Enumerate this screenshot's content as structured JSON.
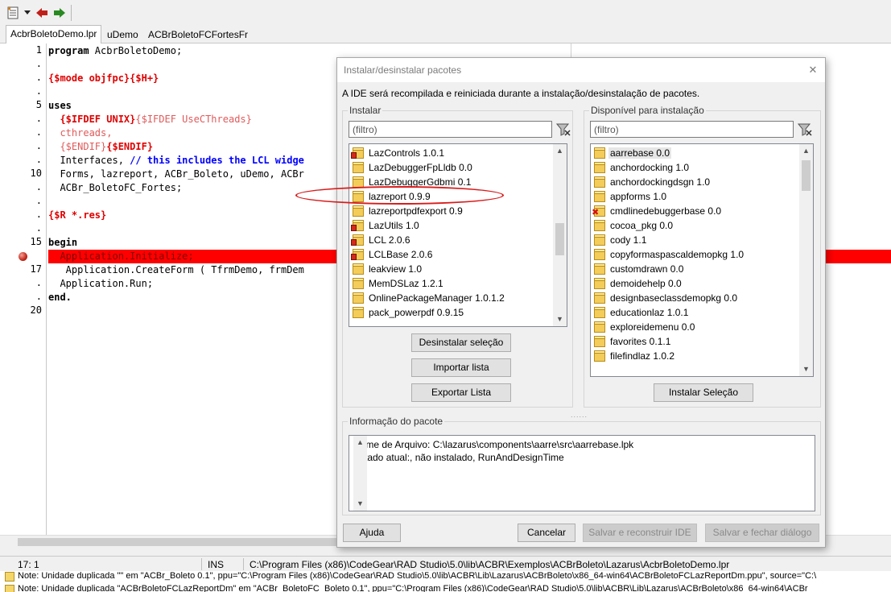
{
  "toolbar": {
    "icons": [
      "document-list-icon",
      "chevron-down-icon",
      "back-arrow-icon",
      "forward-arrow-icon"
    ],
    "colors": {
      "back": "#c0201a",
      "forward": "#2a8a22"
    }
  },
  "tabs": [
    {
      "label": "AcbrBoletoDemo.lpr",
      "active": true
    },
    {
      "label": "uDemo",
      "active": false
    },
    {
      "label": "ACBrBoletoFCFortesFr",
      "active": false
    }
  ],
  "editor": {
    "gutter": [
      "1",
      ".",
      ".",
      ".",
      "5",
      ".",
      ".",
      ".",
      ".",
      "10",
      ".",
      ".",
      ".",
      ".",
      "15",
      "",
      "17",
      ".",
      ".",
      "20"
    ],
    "lines": [
      {
        "parts": [
          {
            "t": "program",
            "c": "kw"
          },
          {
            "t": " AcbrBoletoDemo;",
            "c": "plain"
          }
        ]
      },
      {
        "parts": []
      },
      {
        "parts": [
          {
            "t": "{$mode objfpc}{$H+}",
            "c": "dir"
          }
        ]
      },
      {
        "parts": []
      },
      {
        "parts": [
          {
            "t": "uses",
            "c": "kw"
          }
        ]
      },
      {
        "parts": [
          {
            "t": "  {$IFDEF UNIX}",
            "c": "dir"
          },
          {
            "t": "{$IFDEF UseCThreads}",
            "c": "dirl"
          }
        ]
      },
      {
        "parts": [
          {
            "t": "  cthreads,",
            "c": "dirl"
          }
        ]
      },
      {
        "parts": [
          {
            "t": "  {$ENDIF}",
            "c": "dirl"
          },
          {
            "t": "{$ENDIF}",
            "c": "dir"
          }
        ]
      },
      {
        "parts": [
          {
            "t": "  Interfaces, ",
            "c": "plain"
          },
          {
            "t": "// this includes the LCL widge",
            "c": "cm"
          }
        ]
      },
      {
        "parts": [
          {
            "t": "  Forms, lazreport, ACBr_Boleto, uDemo, ACBr",
            "c": "plain"
          }
        ]
      },
      {
        "parts": [
          {
            "t": "  ACBr_BoletoFC_Fortes;",
            "c": "plain"
          }
        ]
      },
      {
        "parts": []
      },
      {
        "parts": [
          {
            "t": "{$R *.res}",
            "c": "dir"
          }
        ]
      },
      {
        "parts": []
      },
      {
        "parts": [
          {
            "t": "begin",
            "c": "kw"
          }
        ]
      },
      {
        "parts": [
          {
            "t": "  Application.Initialize;",
            "c": "hl-text"
          }
        ]
      },
      {
        "parts": [
          {
            "t": "   Application.CreateForm ( TfrmDemo, frmDem",
            "c": "plain"
          }
        ]
      },
      {
        "parts": [
          {
            "t": "  Application.Run;",
            "c": "plain"
          }
        ]
      },
      {
        "parts": [
          {
            "t": "end.",
            "c": "kw"
          }
        ]
      },
      {
        "parts": []
      }
    ],
    "highlight_color": "#ff0000"
  },
  "status": {
    "position": "17:  1",
    "mode": "INS",
    "file": "C:\\Program Files (x86)\\CodeGear\\RAD Studio\\5.0\\lib\\ACBR\\Exemplos\\ACBrBoleto\\Lazarus\\AcbrBoletoDemo.lpr"
  },
  "messages": [
    "Note: Unidade duplicada \"\" em \"ACBr_Boleto 0.1\", ppu=\"C:\\Program Files (x86)\\CodeGear\\RAD Studio\\5.0\\lib\\ACBR\\Lib\\Lazarus\\ACBrBoleto\\x86_64-win64\\ACBrBoletoFCLazReportDm.ppu\", source=\"C:\\",
    "Note: Unidade duplicada \"ACBrBoletoFCLazReportDm\" em \"ACBr_BoletoFC_Boleto 0.1\", ppu=\"C:\\Program Files (x86)\\CodeGear\\RAD Studio\\5.0\\lib\\ACBR\\Lib\\Lazarus\\ACBrBoleto\\x86_64-win64\\ACBr"
  ],
  "dialog": {
    "title": "Instalar/desinstalar pacotes",
    "close_glyph": "✕",
    "description": "A IDE será recompilada e reiniciada durante a instalação/desinstalação de pacotes.",
    "install": {
      "label": "Instalar",
      "filter_placeholder": "(filtro)",
      "items": [
        {
          "name": "LazControls 1.0.1",
          "mark": "lock"
        },
        {
          "name": "LazDebuggerFpLldb 0.0",
          "mark": "none"
        },
        {
          "name": "LazDebuggerGdbmi 0.1",
          "mark": "none"
        },
        {
          "name": "lazreport 0.9.9",
          "mark": "none"
        },
        {
          "name": "lazreportpdfexport 0.9",
          "mark": "none"
        },
        {
          "name": "LazUtils 1.0",
          "mark": "lock"
        },
        {
          "name": "LCL 2.0.6",
          "mark": "lock"
        },
        {
          "name": "LCLBase 2.0.6",
          "mark": "lock"
        },
        {
          "name": "leakview 1.0",
          "mark": "none"
        },
        {
          "name": "MemDSLaz 1.2.1",
          "mark": "none"
        },
        {
          "name": "OnlinePackageManager 1.0.1.2",
          "mark": "none"
        },
        {
          "name": "pack_powerpdf 0.9.15",
          "mark": "none"
        }
      ],
      "buttons": {
        "uninstall": "Desinstalar seleção",
        "import": "Importar lista",
        "export": "Exportar Lista"
      }
    },
    "available": {
      "label": "Disponível para instalação",
      "filter_placeholder": "(filtro)",
      "items": [
        {
          "name": "aarrebase 0.0",
          "mark": "none",
          "selected": true
        },
        {
          "name": "anchordocking 1.0",
          "mark": "none"
        },
        {
          "name": "anchordockingdsgn 1.0",
          "mark": "none"
        },
        {
          "name": "appforms 1.0",
          "mark": "none"
        },
        {
          "name": "cmdlinedebuggerbase 0.0",
          "mark": "x"
        },
        {
          "name": "cocoa_pkg 0.0",
          "mark": "none"
        },
        {
          "name": "cody 1.1",
          "mark": "none"
        },
        {
          "name": "copyformaspascaldemopkg 1.0",
          "mark": "none"
        },
        {
          "name": "customdrawn 0.0",
          "mark": "none"
        },
        {
          "name": "demoidehelp 0.0",
          "mark": "none"
        },
        {
          "name": "designbaseclassdemopkg 0.0",
          "mark": "none"
        },
        {
          "name": "educationlaz 1.0.1",
          "mark": "none"
        },
        {
          "name": "exploreidemenu 0.0",
          "mark": "none"
        },
        {
          "name": "favorites 0.1.1",
          "mark": "none"
        },
        {
          "name": "filefindlaz 1.0.2",
          "mark": "none"
        }
      ],
      "buttons": {
        "install": "Instalar Seleção"
      }
    },
    "info": {
      "label": "Informação do pacote",
      "lines": [
        "Nome de Arquivo:  C:\\lazarus\\components\\aarre\\src\\aarrebase.lpk",
        "Estado atual:, não instalado, RunAndDesignTime"
      ]
    },
    "footer": {
      "help": "Ajuda",
      "cancel": "Cancelar",
      "save_rebuild": "Salvar e reconstruir IDE",
      "save_close": "Salvar e fechar diálogo"
    },
    "splitter_glyph": "......",
    "scroll_up": "▲",
    "scroll_down": "▼"
  }
}
